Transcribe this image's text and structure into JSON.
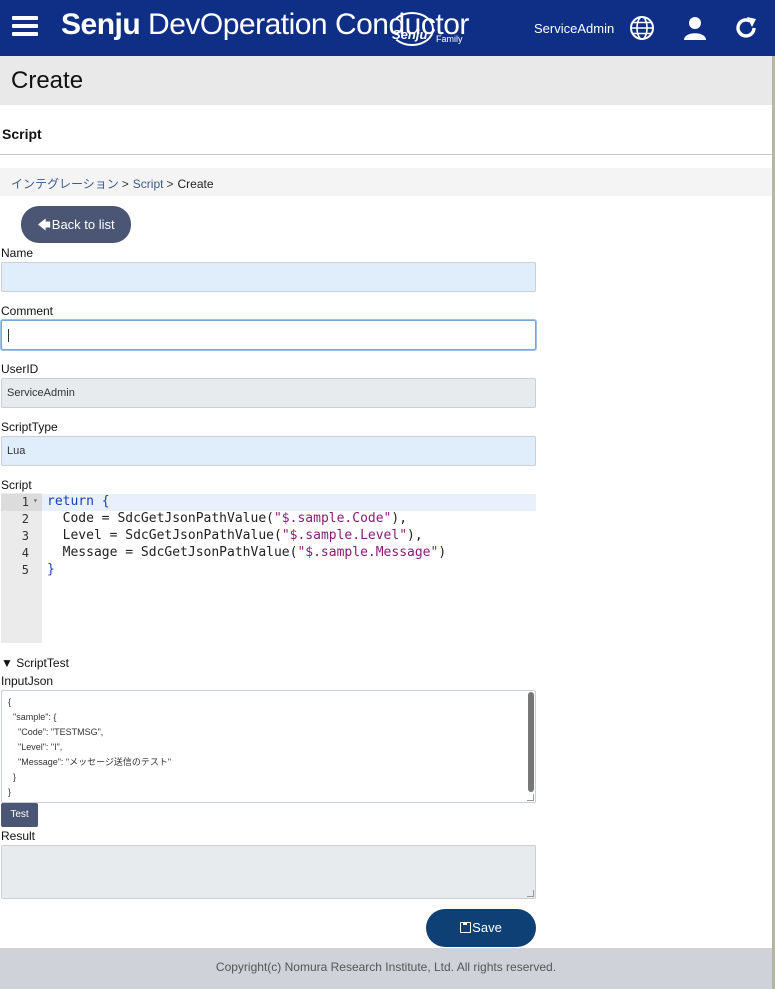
{
  "app": {
    "brand_bold": "Senju",
    "brand_rest": " DevOperation Conductor",
    "brand_logo": "Senju",
    "brand_family": "Family",
    "user": "ServiceAdmin",
    "icons": [
      "menu-icon",
      "globe-icon",
      "user-icon",
      "refresh-icon"
    ]
  },
  "page": {
    "title": "Create",
    "section": "Script"
  },
  "breadcrumb": {
    "items": [
      "インテグレーション",
      "Script"
    ],
    "separator": ">",
    "current": "Create"
  },
  "form": {
    "back_label": "Back to list",
    "name_label": "Name",
    "name_value": "",
    "comment_label": "Comment",
    "comment_value": "",
    "userid_label": "UserID",
    "userid_value": "ServiceAdmin",
    "scripttype_label": "ScriptType",
    "scripttype_value": "Lua",
    "script_label": "Script",
    "script_line_numbers": [
      "1",
      "2",
      "3",
      "4",
      "5"
    ],
    "script_lines": [
      "return {",
      "  Code = SdcGetJsonPathValue(\"$.sample.Code\"),",
      "  Level = SdcGetJsonPathValue(\"$.sample.Level\"),",
      "  Message = SdcGetJsonPathValue(\"$.sample.Message\")",
      "}"
    ],
    "scripttest_label": "ScriptTest",
    "inputjson_label": "InputJson",
    "inputjson_value": "{\n  \"sample\": {\n    \"Code\": \"TESTMSG\",\n    \"Level\": \"I\",\n    \"Message\": \"メッセージ送信のテスト\"\n  }\n}",
    "test_label": "Test",
    "result_label": "Result",
    "result_value": "",
    "save_label": "Save"
  },
  "footer": {
    "copyright": "Copyright(c) Nomura Research Institute, Ltd. All rights reserved."
  },
  "colors": {
    "header": "#0f2f86",
    "button": "#4b5574",
    "save_button": "#0e3f75",
    "input_blue": "#e0eefc",
    "input_gray": "#e8ebee",
    "footer": "#cfd2d9"
  }
}
